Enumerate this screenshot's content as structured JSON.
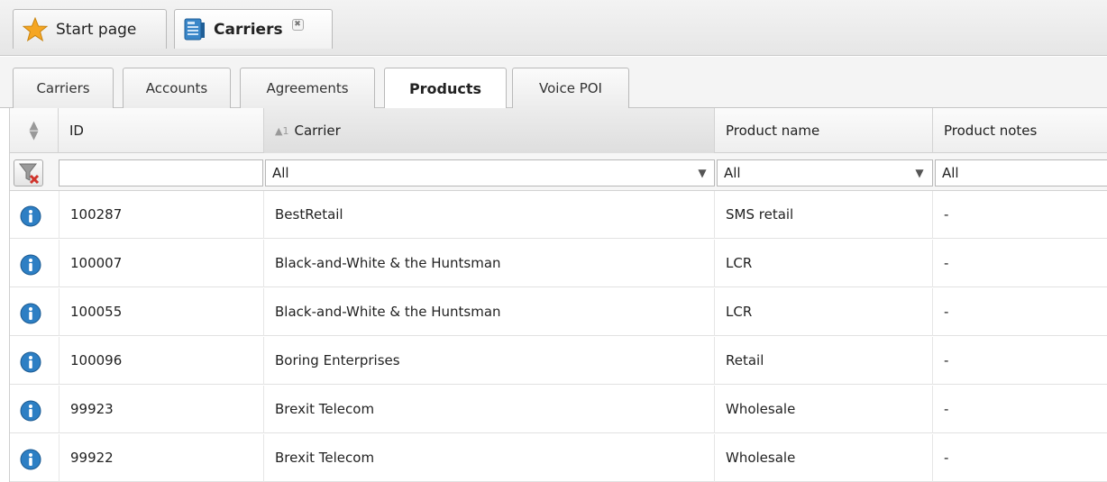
{
  "top_tabs": [
    {
      "label": "Start page",
      "icon": "star-icon"
    },
    {
      "label": "Carriers",
      "icon": "document-icon",
      "closable": true,
      "close_glyph": "✖"
    }
  ],
  "sub_tabs": [
    {
      "label": "Carriers",
      "active": false
    },
    {
      "label": "Accounts",
      "active": false
    },
    {
      "label": "Agreements",
      "active": false
    },
    {
      "label": "Products",
      "active": true
    },
    {
      "label": "Voice POI",
      "active": false
    }
  ],
  "grid": {
    "columns": {
      "id": "ID",
      "carrier": "Carrier",
      "carrier_sort_mark": "▲1",
      "product_name": "Product name",
      "product_notes": "Product notes"
    },
    "filters": {
      "id": "",
      "carrier": "All",
      "product_name": "All",
      "product_notes": "All"
    },
    "rows": [
      {
        "id": "100287",
        "carrier": "BestRetail",
        "product_name": "SMS retail",
        "product_notes": "-"
      },
      {
        "id": "100007",
        "carrier": "Black-and-White & the Huntsman",
        "product_name": "LCR",
        "product_notes": "-"
      },
      {
        "id": "100055",
        "carrier": "Black-and-White & the Huntsman",
        "product_name": "LCR",
        "product_notes": "-"
      },
      {
        "id": "100096",
        "carrier": "Boring Enterprises",
        "product_name": "Retail",
        "product_notes": "-"
      },
      {
        "id": "99923",
        "carrier": "Brexit Telecom",
        "product_name": "Wholesale",
        "product_notes": "-"
      },
      {
        "id": "99922",
        "carrier": "Brexit Telecom",
        "product_name": "Wholesale",
        "product_notes": "-"
      }
    ]
  },
  "colors": {
    "info_blue": "#2d7fc4",
    "star_orange": "#f5a623",
    "filter_clear_red": "#d0342c"
  }
}
